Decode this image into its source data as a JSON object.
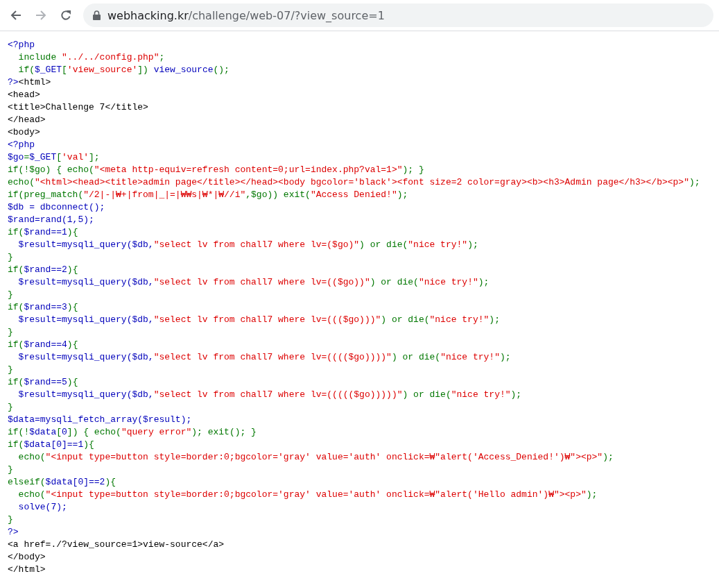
{
  "toolbar": {
    "buttons": [
      {
        "kind": "back",
        "disabled": false
      },
      {
        "kind": "forward",
        "disabled": true
      },
      {
        "kind": "reload",
        "disabled": false
      }
    ],
    "address": {
      "host": "webhacking.kr",
      "path": "/challenge/web-07/?view_source=1"
    }
  },
  "code": [
    [
      {
        "kind": "php",
        "text": "<?php"
      }
    ],
    [
      {
        "kind": "keyword",
        "text": "  include "
      },
      {
        "kind": "string",
        "text": "\"../../config.php\""
      },
      {
        "kind": "keyword",
        "text": ";"
      }
    ],
    [
      {
        "kind": "keyword",
        "text": "  if("
      },
      {
        "kind": "php",
        "text": "$_GET"
      },
      {
        "kind": "keyword",
        "text": "["
      },
      {
        "kind": "string",
        "text": "'view_source'"
      },
      {
        "kind": "keyword",
        "text": "]) "
      },
      {
        "kind": "php",
        "text": "view_source"
      },
      {
        "kind": "keyword",
        "text": "();"
      }
    ],
    [
      {
        "kind": "php",
        "text": "?>"
      },
      {
        "kind": "html",
        "text": "<html>"
      }
    ],
    [
      {
        "kind": "html",
        "text": "<head>"
      }
    ],
    [
      {
        "kind": "html",
        "text": "<title>Challenge 7</title>"
      }
    ],
    [
      {
        "kind": "html",
        "text": "</head>"
      }
    ],
    [
      {
        "kind": "html",
        "text": "<body>"
      }
    ],
    [
      {
        "kind": "php",
        "text": "<?php"
      }
    ],
    [
      {
        "kind": "php",
        "text": "$go"
      },
      {
        "kind": "keyword",
        "text": "="
      },
      {
        "kind": "php",
        "text": "$_GET"
      },
      {
        "kind": "keyword",
        "text": "["
      },
      {
        "kind": "string",
        "text": "'val'"
      },
      {
        "kind": "keyword",
        "text": "];"
      }
    ],
    [
      {
        "kind": "keyword",
        "text": "if(!$go) { echo("
      },
      {
        "kind": "string",
        "text": "\"<meta http-equiv=refresh content=0;url=index.php?val=1>\""
      },
      {
        "kind": "keyword",
        "text": "); }"
      }
    ],
    [
      {
        "kind": "keyword",
        "text": "echo("
      },
      {
        "kind": "string",
        "text": "\"<html><head><title>admin page</title></head><body bgcolor='black'><font size=2 color=gray><b><h3>Admin page</h3></b><p>\""
      },
      {
        "kind": "keyword",
        "text": ");"
      }
    ],
    [
      {
        "kind": "keyword",
        "text": "if(preg_match("
      },
      {
        "kind": "string",
        "text": "\"/2|-|₩+|from|_|=|₩₩s|₩*|₩//i\""
      },
      {
        "kind": "keyword",
        "text": ",$go)) exit("
      },
      {
        "kind": "string",
        "text": "\"Access Denied!\""
      },
      {
        "kind": "keyword",
        "text": ");"
      }
    ],
    [
      {
        "kind": "php",
        "text": "$db = dbconnect();"
      }
    ],
    [
      {
        "kind": "php",
        "text": "$rand=rand(1,5);"
      }
    ],
    [
      {
        "kind": "keyword",
        "text": "if("
      },
      {
        "kind": "php",
        "text": "$rand==1"
      },
      {
        "kind": "keyword",
        "text": "){"
      }
    ],
    [
      {
        "kind": "php",
        "text": "  $result=mysqli_query($db,"
      },
      {
        "kind": "string",
        "text": "\"select lv from chall7 where lv=($go)\""
      },
      {
        "kind": "keyword",
        "text": ") or die("
      },
      {
        "kind": "string",
        "text": "\"nice try!\""
      },
      {
        "kind": "keyword",
        "text": ");"
      }
    ],
    [
      {
        "kind": "keyword",
        "text": "}"
      }
    ],
    [
      {
        "kind": "keyword",
        "text": "if("
      },
      {
        "kind": "php",
        "text": "$rand==2"
      },
      {
        "kind": "keyword",
        "text": "){"
      }
    ],
    [
      {
        "kind": "php",
        "text": "  $result=mysqli_query($db,"
      },
      {
        "kind": "string",
        "text": "\"select lv from chall7 where lv=(($go))\""
      },
      {
        "kind": "keyword",
        "text": ") or die("
      },
      {
        "kind": "string",
        "text": "\"nice try!\""
      },
      {
        "kind": "keyword",
        "text": ");"
      }
    ],
    [
      {
        "kind": "keyword",
        "text": "}"
      }
    ],
    [
      {
        "kind": "keyword",
        "text": "if("
      },
      {
        "kind": "php",
        "text": "$rand==3"
      },
      {
        "kind": "keyword",
        "text": "){"
      }
    ],
    [
      {
        "kind": "php",
        "text": "  $result=mysqli_query($db,"
      },
      {
        "kind": "string",
        "text": "\"select lv from chall7 where lv=((($go)))\""
      },
      {
        "kind": "keyword",
        "text": ") or die("
      },
      {
        "kind": "string",
        "text": "\"nice try!\""
      },
      {
        "kind": "keyword",
        "text": ");"
      }
    ],
    [
      {
        "kind": "keyword",
        "text": "}"
      }
    ],
    [
      {
        "kind": "keyword",
        "text": "if("
      },
      {
        "kind": "php",
        "text": "$rand==4"
      },
      {
        "kind": "keyword",
        "text": "){"
      }
    ],
    [
      {
        "kind": "php",
        "text": "  $result=mysqli_query($db,"
      },
      {
        "kind": "string",
        "text": "\"select lv from chall7 where lv=(((($go))))\""
      },
      {
        "kind": "keyword",
        "text": ") or die("
      },
      {
        "kind": "string",
        "text": "\"nice try!\""
      },
      {
        "kind": "keyword",
        "text": ");"
      }
    ],
    [
      {
        "kind": "keyword",
        "text": "}"
      }
    ],
    [
      {
        "kind": "keyword",
        "text": "if("
      },
      {
        "kind": "php",
        "text": "$rand==5"
      },
      {
        "kind": "keyword",
        "text": "){"
      }
    ],
    [
      {
        "kind": "php",
        "text": "  $result=mysqli_query($db,"
      },
      {
        "kind": "string",
        "text": "\"select lv from chall7 where lv=((((($go)))))\""
      },
      {
        "kind": "keyword",
        "text": ") or die("
      },
      {
        "kind": "string",
        "text": "\"nice try!\""
      },
      {
        "kind": "keyword",
        "text": ");"
      }
    ],
    [
      {
        "kind": "keyword",
        "text": "}"
      }
    ],
    [
      {
        "kind": "php",
        "text": "$data=mysqli_fetch_array($result);"
      }
    ],
    [
      {
        "kind": "keyword",
        "text": "if(!"
      },
      {
        "kind": "php",
        "text": "$data"
      },
      {
        "kind": "keyword",
        "text": "["
      },
      {
        "kind": "php",
        "text": "0"
      },
      {
        "kind": "keyword",
        "text": "]) { echo("
      },
      {
        "kind": "string",
        "text": "\"query error\""
      },
      {
        "kind": "keyword",
        "text": "); exit(); }"
      }
    ],
    [
      {
        "kind": "keyword",
        "text": "if("
      },
      {
        "kind": "php",
        "text": "$data[0]==1"
      },
      {
        "kind": "keyword",
        "text": "){"
      }
    ],
    [
      {
        "kind": "keyword",
        "text": "  echo("
      },
      {
        "kind": "string",
        "text": "\"<input type=button style=border:0;bgcolor='gray' value='auth' onclick=₩\"alert('Access_Denied!')₩\"><p>\""
      },
      {
        "kind": "keyword",
        "text": ");"
      }
    ],
    [
      {
        "kind": "keyword",
        "text": "}"
      }
    ],
    [
      {
        "kind": "keyword",
        "text": "elseif("
      },
      {
        "kind": "php",
        "text": "$data[0]==2"
      },
      {
        "kind": "keyword",
        "text": "){"
      }
    ],
    [
      {
        "kind": "keyword",
        "text": "  echo("
      },
      {
        "kind": "string",
        "text": "\"<input type=button style=border:0;bgcolor='gray' value='auth' onclick=₩\"alert('Hello admin')₩\"><p>\""
      },
      {
        "kind": "keyword",
        "text": ");"
      }
    ],
    [
      {
        "kind": "php",
        "text": "  solve(7);"
      }
    ],
    [
      {
        "kind": "keyword",
        "text": "}"
      }
    ],
    [
      {
        "kind": "php",
        "text": "?>"
      }
    ],
    [
      {
        "kind": "html",
        "text": "<a href=./?view_source=1>view-source</a>"
      }
    ],
    [
      {
        "kind": "html",
        "text": "</body>"
      }
    ],
    [
      {
        "kind": "html",
        "text": "</html>"
      }
    ]
  ]
}
